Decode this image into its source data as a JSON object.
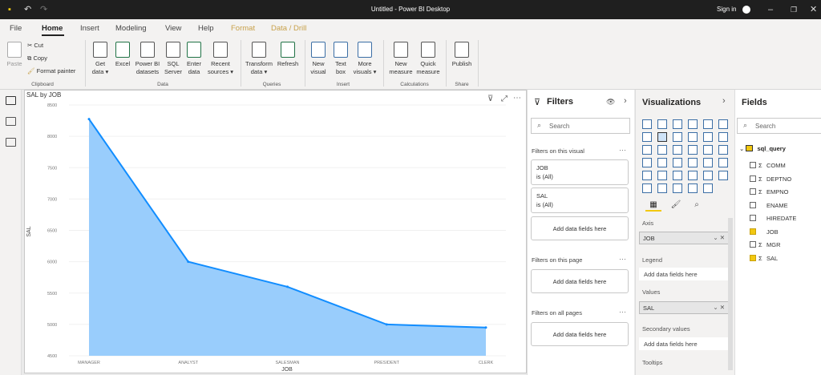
{
  "window": {
    "title": "Untitled - Power BI Desktop",
    "sign_in": "Sign in"
  },
  "menu": {
    "tabs": [
      "File",
      "Home",
      "Insert",
      "Modeling",
      "View",
      "Help",
      "Format",
      "Data / Drill"
    ]
  },
  "ribbon": {
    "clipboard": {
      "paste": "Paste",
      "cut": "Cut",
      "copy": "Copy",
      "format_painter": "Format painter",
      "group": "Clipboard"
    },
    "data": {
      "get_data": [
        "Get",
        "data ▾"
      ],
      "excel": "Excel",
      "pbi": [
        "Power BI",
        "datasets"
      ],
      "sql": [
        "SQL",
        "Server"
      ],
      "enter": [
        "Enter",
        "data"
      ],
      "recent": [
        "Recent",
        "sources ▾"
      ],
      "group": "Data"
    },
    "queries": {
      "transform": [
        "Transform",
        "data ▾"
      ],
      "refresh": "Refresh",
      "group": "Queries"
    },
    "insert": {
      "new_visual": [
        "New",
        "visual"
      ],
      "text_box": [
        "Text",
        "box"
      ],
      "more_visuals": [
        "More",
        "visuals ▾"
      ],
      "group": "Insert"
    },
    "calculations": {
      "new_measure": [
        "New",
        "measure"
      ],
      "quick_measure": [
        "Quick",
        "measure"
      ],
      "group": "Calculations"
    },
    "share": {
      "publish": "Publish",
      "group": "Share"
    }
  },
  "chart_data": {
    "type": "area",
    "title": "SAL by JOB",
    "xlabel": "JOB",
    "ylabel": "SAL",
    "categories": [
      "MANAGER",
      "ANALYST",
      "SALESMAN",
      "PRESIDENT",
      "CLERK"
    ],
    "values": [
      8275,
      6000,
      5600,
      5000,
      4950
    ],
    "ylim": [
      4500,
      8500
    ],
    "yticks": [
      4500,
      5000,
      5500,
      6000,
      6500,
      7000,
      7500,
      8000,
      8500
    ],
    "fill_color": "#99cdfc",
    "line_color": "#118dff"
  },
  "filters": {
    "title": "Filters",
    "search_placeholder": "Search",
    "on_visual": "Filters on this visual",
    "cards": [
      {
        "field": "JOB",
        "state": "is (All)"
      },
      {
        "field": "SAL",
        "state": "is (All)"
      }
    ],
    "add_fields": "Add data fields here",
    "on_page": "Filters on this page",
    "on_all": "Filters on all pages"
  },
  "visualizations": {
    "title": "Visualizations",
    "axis_label": "Axis",
    "axis_field": "JOB",
    "legend_label": "Legend",
    "values_label": "Values",
    "values_field": "SAL",
    "secondary_label": "Secondary values",
    "tooltips_label": "Tooltips",
    "add_fields": "Add data fields here"
  },
  "fields": {
    "title": "Fields",
    "search_placeholder": "Search",
    "table_name": "sql_query",
    "items": [
      {
        "name": "COMM",
        "sigma": "Σ",
        "checked": false
      },
      {
        "name": "DEPTNO",
        "sigma": "Σ",
        "checked": false
      },
      {
        "name": "EMPNO",
        "sigma": "Σ",
        "checked": false
      },
      {
        "name": "ENAME",
        "sigma": "",
        "checked": false
      },
      {
        "name": "HIREDATE",
        "sigma": "",
        "checked": false
      },
      {
        "name": "JOB",
        "sigma": "",
        "checked": true
      },
      {
        "name": "MGR",
        "sigma": "Σ",
        "checked": false
      },
      {
        "name": "SAL",
        "sigma": "Σ",
        "checked": true
      }
    ]
  }
}
